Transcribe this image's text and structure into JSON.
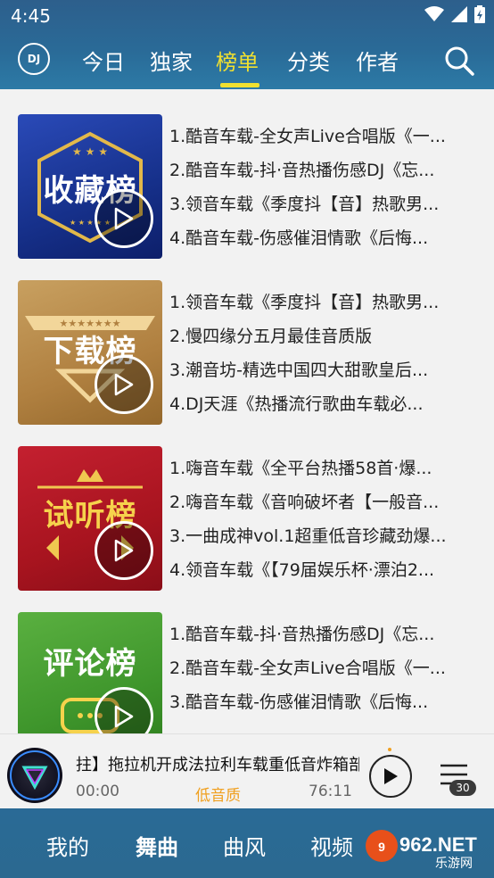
{
  "status_bar": {
    "time": "4:45"
  },
  "header": {
    "logo_text": "DJ",
    "tabs": [
      {
        "label": "今日",
        "active": false
      },
      {
        "label": "独家",
        "active": false
      },
      {
        "label": "榜单",
        "active": true
      },
      {
        "label": "分类",
        "active": false
      },
      {
        "label": "作者",
        "active": false
      }
    ],
    "search_icon": "search-icon"
  },
  "charts": [
    {
      "cover_title": "收藏榜",
      "tracks": [
        "1.酷音车载-全女声Live合唱版《一...",
        "2.酷音车载-抖·音热播伤感DJ《忘...",
        "3.领音车载《季度抖【音】热歌男...",
        "4.酷音车载-伤感催泪情歌《后悔..."
      ]
    },
    {
      "cover_title": "下载榜",
      "tracks": [
        "1.领音车载《季度抖【音】热歌男...",
        "2.慢四缘分五月最佳音质版",
        "3.潮音坊-精选中国四大甜歌皇后...",
        "4.DJ天涯《热播流行歌曲车载必..."
      ]
    },
    {
      "cover_title": "试听榜",
      "tracks": [
        "1.嗨音车载《全平台热播58首·爆...",
        "2.嗨音车载《音响破坏者【一般音...",
        "3.一曲成神vol.1超重低音珍藏劲爆...",
        "4.领音车载《【79届娱乐杯·漂泊2..."
      ]
    },
    {
      "cover_title": "评论榜",
      "tracks": [
        "1.酷音车载-抖·音热播伤感DJ《忘...",
        "2.酷音车载-全女声Live合唱版《一...",
        "3.酷音车载-伤感催泪情歌《后悔..."
      ]
    }
  ],
  "player": {
    "song": "拄】拖拉机开成法拉利车载重低音炸箱部",
    "position": "00:00",
    "quality": "低音质",
    "duration": "76:11",
    "queue_count": "30"
  },
  "bottom_nav": [
    {
      "label": "我的",
      "active": false
    },
    {
      "label": "舞曲",
      "active": true
    },
    {
      "label": "曲风",
      "active": false
    },
    {
      "label": "视频",
      "active": false
    }
  ],
  "watermark": {
    "text": "962.NET",
    "subtext": "乐游网"
  }
}
